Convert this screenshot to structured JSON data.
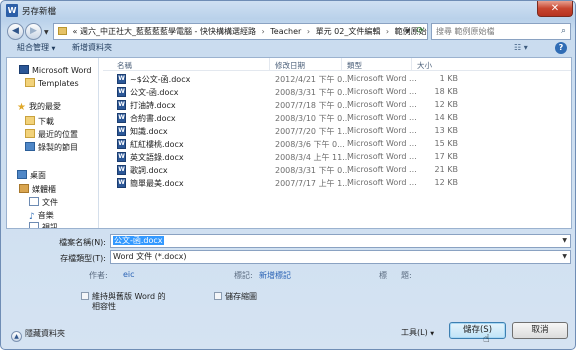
{
  "window": {
    "title": "另存新檔",
    "close_glyph": "✕",
    "app_icon_letter": "W"
  },
  "address_bar": {
    "prefix": "«",
    "crumbs": [
      "週六_中正社大_藍藍藍藍學電腦 - 快快構構選經路",
      "Teacher",
      "單元 02_文件編輯",
      "範例原始檔"
    ],
    "search_placeholder": "搜尋 範例原始檔"
  },
  "toolbar": {
    "organize_label": "組合管理",
    "new_folder_label": "新增資料夾"
  },
  "nav_pane": {
    "items": [
      {
        "label": "Microsoft Word",
        "icon": "word-icon"
      },
      {
        "label": "Templates",
        "icon": "folder-icon"
      },
      {
        "label": "我的最愛",
        "icon": "star-icon"
      },
      {
        "label": "下載",
        "icon": "download-icon"
      },
      {
        "label": "最近的位置",
        "icon": "recent-places-icon"
      },
      {
        "label": "錄製的節目",
        "icon": "recorded-tv-icon"
      },
      {
        "label": "桌面",
        "icon": "desktop-icon"
      },
      {
        "label": "媒體櫃",
        "icon": "libraries-icon"
      },
      {
        "label": "文件",
        "icon": "documents-icon"
      },
      {
        "label": "音樂",
        "icon": "music-icon"
      },
      {
        "label": "視訊",
        "icon": "videos-icon"
      }
    ]
  },
  "file_list": {
    "columns": [
      "名稱",
      "修改日期",
      "類型",
      "大小"
    ],
    "rows": [
      {
        "name": "~$公文-函.docx",
        "date": "2012/4/21 下午 0...",
        "type": "Microsoft Word ...",
        "size": "1 KB"
      },
      {
        "name": "公文-函.docx",
        "date": "2008/3/31 下午 0...",
        "type": "Microsoft Word ...",
        "size": "18 KB"
      },
      {
        "name": "打油詩.docx",
        "date": "2007/7/18 下午 0...",
        "type": "Microsoft Word ...",
        "size": "12 KB"
      },
      {
        "name": "合約書.docx",
        "date": "2008/3/10 下午 0...",
        "type": "Microsoft Word ...",
        "size": "14 KB"
      },
      {
        "name": "知識.docx",
        "date": "2007/7/20 下午 1...",
        "type": "Microsoft Word ...",
        "size": "13 KB"
      },
      {
        "name": "紅紅樓桃.docx",
        "date": "2008/3/6 下午 0...",
        "type": "Microsoft Word ...",
        "size": "15 KB"
      },
      {
        "name": "英文語錄.docx",
        "date": "2008/3/4 上午 11...",
        "type": "Microsoft Word ...",
        "size": "17 KB"
      },
      {
        "name": "歌詞.docx",
        "date": "2008/3/31 下午 0...",
        "type": "Microsoft Word ...",
        "size": "21 KB"
      },
      {
        "name": "簡單最美.docx",
        "date": "2007/7/17 上午 1...",
        "type": "Microsoft Word ...",
        "size": "12 KB"
      }
    ]
  },
  "save_fields": {
    "filename_label": "檔案名稱(N):",
    "filename_value": "公文-函.docx",
    "filetype_label": "存檔類型(T):",
    "filetype_value": "Word 文件 (*.docx)",
    "author_label": "作者:",
    "author_value": "eic",
    "tags_label": "標記:",
    "tags_value": "新增標記",
    "title_label": "標",
    "title_label2": "題:",
    "maintain_compat_label_line1": "維持與舊版 Word 的",
    "maintain_compat_label_line2": "相容性",
    "save_thumbnail_label": "儲存縮圖"
  },
  "bottom": {
    "hide_folders_label": "隱藏資料夾",
    "tools_label": "工具(L)",
    "save_button": "儲存(S)",
    "cancel_button": "取消"
  }
}
